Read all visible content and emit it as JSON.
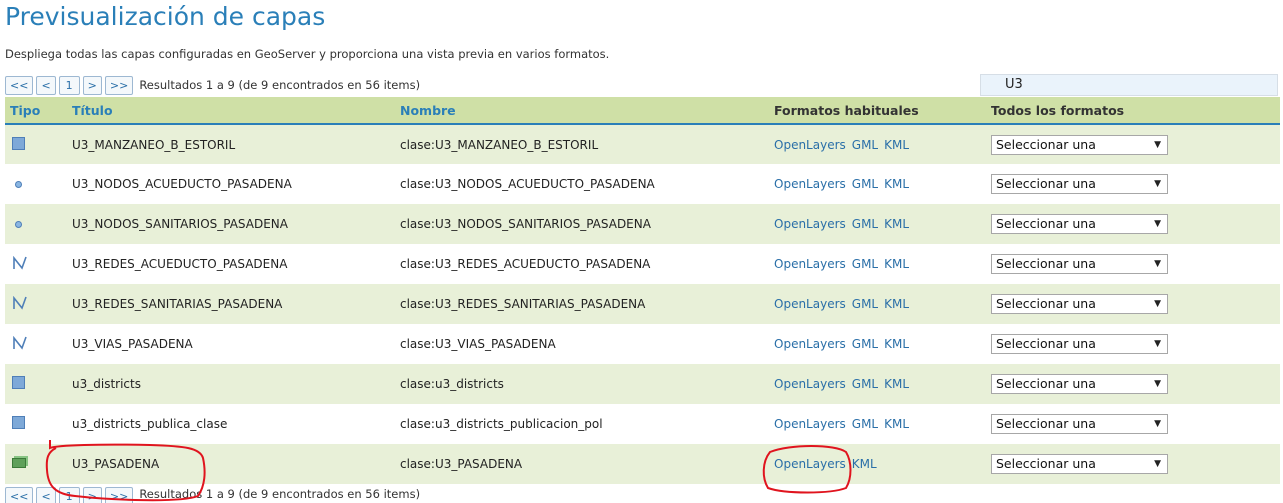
{
  "page": {
    "title": "Previsualización de capas",
    "description": "Despliega todas las capas configuradas en GeoServer y proporciona una vista previa en varios formatos."
  },
  "pager": {
    "first": "<<",
    "prev": "<",
    "page": "1",
    "next": ">",
    "last": ">>",
    "results": "Resultados 1 a 9 (de 9 encontrados en 56 items)"
  },
  "search": {
    "value": "U3"
  },
  "table": {
    "headers": {
      "tipo": "Tipo",
      "titulo": "Título",
      "nombre": "Nombre",
      "formatos": "Formatos habituales",
      "todos": "Todos los formatos"
    },
    "rows": [
      {
        "type": "polygon-icon",
        "title": "U3_MANZANEO_B_ESTORIL",
        "name": "clase:U3_MANZANEO_B_ESTORIL",
        "links": [
          "OpenLayers",
          "GML",
          "KML"
        ],
        "select": "Seleccionar una"
      },
      {
        "type": "point-icon",
        "title": "U3_NODOS_ACUEDUCTO_PASADENA",
        "name": "clase:U3_NODOS_ACUEDUCTO_PASADENA",
        "links": [
          "OpenLayers",
          "GML",
          "KML"
        ],
        "select": "Seleccionar una"
      },
      {
        "type": "point-icon",
        "title": "U3_NODOS_SANITARIOS_PASADENA",
        "name": "clase:U3_NODOS_SANITARIOS_PASADENA",
        "links": [
          "OpenLayers",
          "GML",
          "KML"
        ],
        "select": "Seleccionar una"
      },
      {
        "type": "line-icon",
        "title": "U3_REDES_ACUEDUCTO_PASADENA",
        "name": "clase:U3_REDES_ACUEDUCTO_PASADENA",
        "links": [
          "OpenLayers",
          "GML",
          "KML"
        ],
        "select": "Seleccionar una"
      },
      {
        "type": "line-icon",
        "title": "U3_REDES_SANITARIAS_PASADENA",
        "name": "clase:U3_REDES_SANITARIAS_PASADENA",
        "links": [
          "OpenLayers",
          "GML",
          "KML"
        ],
        "select": "Seleccionar una"
      },
      {
        "type": "line-icon",
        "title": "U3_VIAS_PASADENA",
        "name": "clase:U3_VIAS_PASADENA",
        "links": [
          "OpenLayers",
          "GML",
          "KML"
        ],
        "select": "Seleccionar una"
      },
      {
        "type": "polygon-icon",
        "title": "u3_districts",
        "name": "clase:u3_districts",
        "links": [
          "OpenLayers",
          "GML",
          "KML"
        ],
        "select": "Seleccionar una"
      },
      {
        "type": "polygon-icon",
        "title": "u3_districts_publica_clase",
        "name": "clase:u3_districts_publicacion_pol",
        "links": [
          "OpenLayers",
          "GML",
          "KML"
        ],
        "select": "Seleccionar una"
      },
      {
        "type": "raster-icon",
        "title": "U3_PASADENA",
        "name": "clase:U3_PASADENA",
        "links": [
          "OpenLayers",
          "KML"
        ],
        "select": "Seleccionar una"
      }
    ]
  },
  "bottom_pager": {
    "results": "Resultados 1 a 9 (de 9 encontrados en 56 items)"
  },
  "colors": {
    "accent": "#2a7fb8",
    "header_bg": "#cfe0a6",
    "row_alt": "#e8f0d8",
    "annotation": "#e0141e"
  }
}
